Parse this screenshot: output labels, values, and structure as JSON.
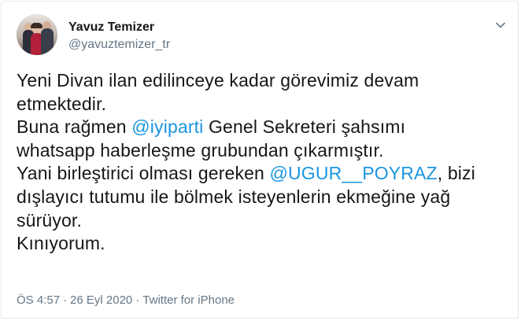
{
  "author": {
    "name": "Yavuz Temizer",
    "handle": "@yavuztemizer_tr",
    "avatar_icon": "profile-photo"
  },
  "menu": {
    "icon": "chevron-down-icon"
  },
  "tweet": {
    "line1": "Yeni Divan ilan edilinceye kadar görevimiz devam",
    "line2": "etmektedir.",
    "line3_pre": "Buna rağmen ",
    "line3_mention": "@iyiparti",
    "line3_post": " Genel Sekreteri şahsımı",
    "line4": "whatsapp haberleşme grubundan çıkarmıştır.",
    "line5_pre": "Yani birleştirici olması gereken ",
    "line5_mention": "@UGUR__POYRAZ",
    "line5_post": ", bizi",
    "line6": "dışlayıcı tutumu ile bölmek isteyenlerin ekmeğine yağ",
    "line7": "sürüyor.",
    "line8": "Kınıyorum."
  },
  "meta": {
    "time": "ÖS 4:57",
    "separator": "·",
    "date": "26 Eyl 2020",
    "source": "Twitter for iPhone"
  },
  "colors": {
    "mention": "#1b95e0",
    "secondary_text": "#657786",
    "primary_text": "#14171a",
    "border": "#e1e8ed"
  }
}
